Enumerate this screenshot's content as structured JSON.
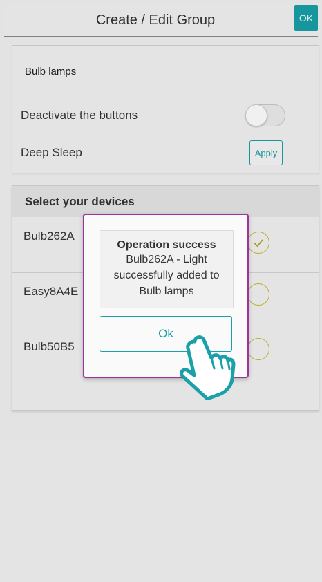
{
  "header": {
    "title": "Create / Edit Group",
    "ok_label": "OK"
  },
  "group": {
    "name": "Bulb lamps",
    "deactivate_label": "Deactivate the buttons",
    "deactivate_on": false,
    "deep_sleep_label": "Deep Sleep",
    "apply_label": "Apply"
  },
  "devices": {
    "title": "Select your devices",
    "items": [
      {
        "name": "Bulb262A",
        "checked": true
      },
      {
        "name": "Easy8A4E",
        "checked": false
      },
      {
        "name": "Bulb50B5",
        "checked": false
      }
    ]
  },
  "dialog": {
    "title": "Operation success",
    "message": "Bulb262A - Light successfully added to Bulb lamps",
    "ok_label": "Ok"
  },
  "colors": {
    "accent": "#1aa0a8",
    "dialog_border": "#a0339b",
    "check": "#c8bb36"
  }
}
